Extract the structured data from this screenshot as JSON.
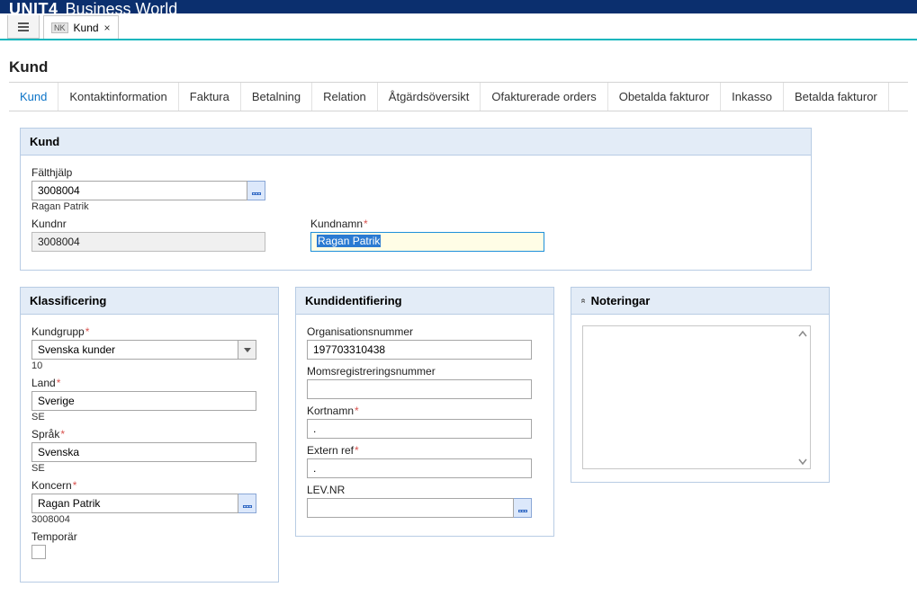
{
  "app": {
    "title_bold": "UNIT4",
    "title_light": "Business World"
  },
  "doc_tab": {
    "badge": "NK",
    "label": "Kund",
    "close": "×"
  },
  "page_title": "Kund",
  "subtabs": [
    "Kund",
    "Kontaktinformation",
    "Faktura",
    "Betalning",
    "Relation",
    "Åtgärdsöversikt",
    "Ofakturerade orders",
    "Obetalda fakturor",
    "Inkasso",
    "Betalda fakturor"
  ],
  "panel_kund": {
    "title": "Kund",
    "faelthjaelp": {
      "label": "Fälthjälp",
      "value": "3008004",
      "subtext": "Ragan Patrik"
    },
    "kundnr": {
      "label": "Kundnr",
      "value": "3008004"
    },
    "kundnamn": {
      "label": "Kundnamn",
      "value": "Ragan Patrik"
    }
  },
  "panel_klass": {
    "title": "Klassificering",
    "kundgrupp": {
      "label": "Kundgrupp",
      "value": "Svenska kunder",
      "subtext": "10"
    },
    "land": {
      "label": "Land",
      "value": "Sverige",
      "subtext": "SE"
    },
    "sprak": {
      "label": "Språk",
      "value": "Svenska",
      "subtext": "SE"
    },
    "koncern": {
      "label": "Koncern",
      "value": "Ragan Patrik",
      "subtext": "3008004"
    },
    "temporar": {
      "label": "Temporär"
    }
  },
  "panel_ident": {
    "title": "Kundidentifiering",
    "orgnr": {
      "label": "Organisationsnummer",
      "value": "197703310438"
    },
    "moms": {
      "label": "Momsregistreringsnummer",
      "value": ""
    },
    "kortnamn": {
      "label": "Kortnamn",
      "value": "."
    },
    "externref": {
      "label": "Extern ref",
      "value": "."
    },
    "levnr": {
      "label": "LEV.NR",
      "value": ""
    }
  },
  "panel_notes": {
    "title": "Noteringar",
    "collapse_glyph": "«"
  }
}
